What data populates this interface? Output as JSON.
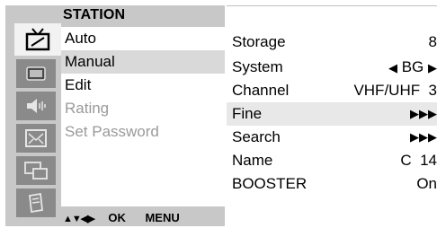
{
  "menu": {
    "title": "STATION",
    "icons": [
      "antenna-tv-icon",
      "screen-icon",
      "speaker-icon",
      "clock-screen-icon",
      "multi-window-icon",
      "lock-icon"
    ],
    "active_icon": 0,
    "items": [
      {
        "label": "Auto",
        "state": "normal"
      },
      {
        "label": "Manual",
        "state": "selected"
      },
      {
        "label": "Edit",
        "state": "normal"
      },
      {
        "label": "Rating",
        "state": "disabled"
      },
      {
        "label": "Set Password",
        "state": "disabled"
      }
    ],
    "footer": {
      "arrows": "▲▼◀▶",
      "ok": "OK",
      "menu": "MENU"
    }
  },
  "settings": {
    "rows": [
      {
        "label": "Storage",
        "value": "8"
      },
      {
        "label": "System",
        "value_left": "◀",
        "value": "BG",
        "value_right": "▶"
      },
      {
        "label": "Channel",
        "value": "VHF/UHF  3"
      },
      {
        "label": "Fine",
        "value": "▶▶▶",
        "selected": true
      },
      {
        "label": "Search",
        "value": "▶▶▶"
      },
      {
        "label": "Name",
        "value": "C  14"
      },
      {
        "label": "BOOSTER",
        "value": "On"
      }
    ]
  },
  "colors": {
    "panel": "#c8c8c8",
    "icon_tile": "#8a8a8a",
    "selected_row": "#d9d9d9",
    "disabled_text": "#9a9a9a"
  }
}
